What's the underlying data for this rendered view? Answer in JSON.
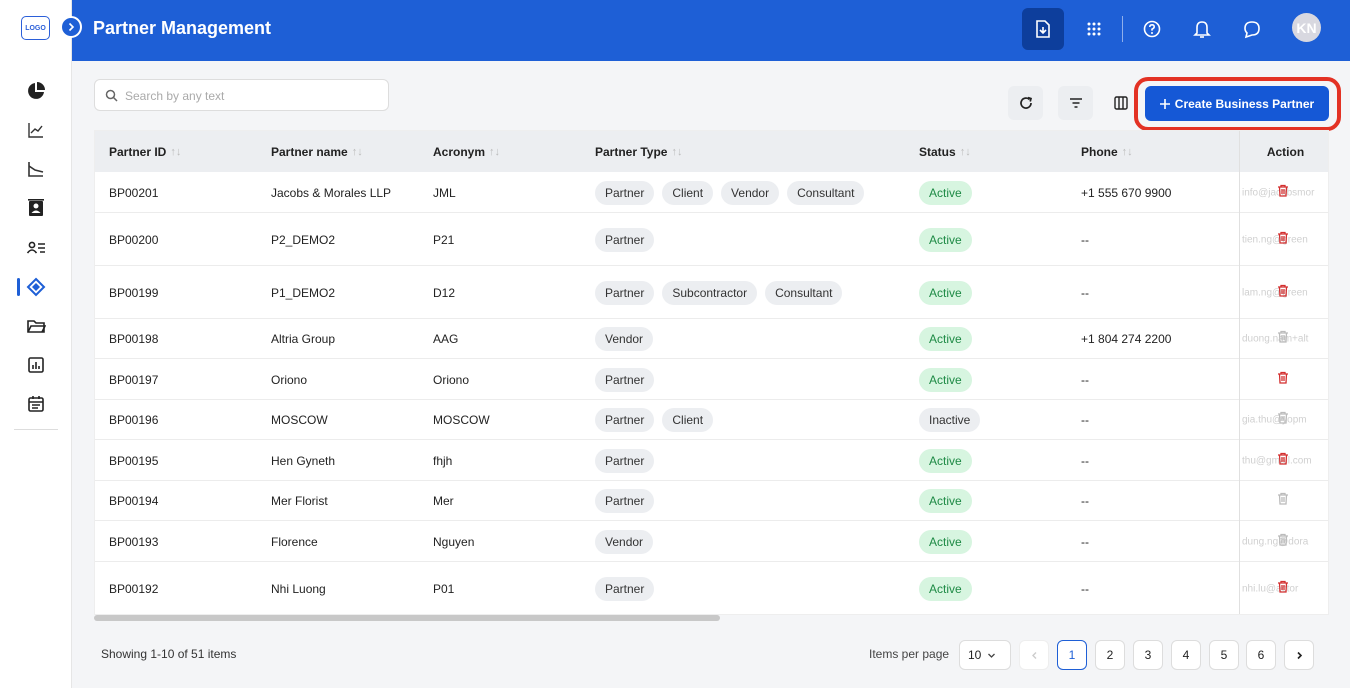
{
  "app": {
    "logo_text": "LOGO",
    "title": "Partner Management",
    "avatar_initials": "KN",
    "accent": "#1e5fd6"
  },
  "sidebar": {
    "items": [
      {
        "icon": "pie-chart-icon"
      },
      {
        "icon": "trend-chart-icon"
      },
      {
        "icon": "area-chart-icon"
      },
      {
        "icon": "contacts-icon"
      },
      {
        "icon": "user-list-icon"
      },
      {
        "icon": "handshake-icon",
        "active": true
      },
      {
        "icon": "folder-icon"
      },
      {
        "icon": "report-icon"
      },
      {
        "icon": "calendar-icon"
      }
    ]
  },
  "toolbar": {
    "search_placeholder": "Search by any text",
    "create_label": "Create Business Partner"
  },
  "table": {
    "headers": [
      "Partner ID",
      "Partner name",
      "Acronym",
      "Partner Type",
      "Status",
      "Phone",
      "Action"
    ],
    "rows": [
      {
        "id": "BP00201",
        "name": "Jacobs & Morales LLP",
        "acronym": "JML",
        "types": [
          "Partner",
          "Client",
          "Vendor",
          "Consultant"
        ],
        "status": "Active",
        "phone": "+1 555 670 9900",
        "ghost": "info@jacobsmor"
      },
      {
        "id": "BP00200",
        "name": "P2_DEMO2",
        "acronym": "P21",
        "types": [
          "Partner"
        ],
        "status": "Active",
        "phone": "--",
        "ghost": "tien.ng@green"
      },
      {
        "id": "BP00199",
        "name": "P1_DEMO2",
        "acronym": "D12",
        "types": [
          "Partner",
          "Subcontractor",
          "Consultant"
        ],
        "status": "Active",
        "phone": "--",
        "ghost": "lam.ng@green"
      },
      {
        "id": "BP00198",
        "name": "Altria Group",
        "acronym": "AAG",
        "types": [
          "Vendor"
        ],
        "status": "Active",
        "phone": "+1 804 274 2200",
        "ghost": "duong.nam+alt"
      },
      {
        "id": "BP00197",
        "name": "Oriono",
        "acronym": "Oriono",
        "types": [
          "Partner"
        ],
        "status": "Active",
        "phone": "--",
        "ghost": ""
      },
      {
        "id": "BP00196",
        "name": "MOSCOW",
        "acronym": "MOSCOW",
        "types": [
          "Partner",
          "Client"
        ],
        "status": "Inactive",
        "phone": "--",
        "ghost": "gia.thu@yopm"
      },
      {
        "id": "BP00195",
        "name": "Hen Gyneth",
        "acronym": "fhjh",
        "types": [
          "Partner"
        ],
        "status": "Active",
        "phone": "--",
        "ghost": "thu@gmail.com"
      },
      {
        "id": "BP00194",
        "name": "Mer Florist",
        "acronym": "Mer",
        "types": [
          "Partner"
        ],
        "status": "Active",
        "phone": "--",
        "ghost": ""
      },
      {
        "id": "BP00193",
        "name": "Florence",
        "acronym": "Nguyen",
        "types": [
          "Vendor"
        ],
        "status": "Active",
        "phone": "--",
        "ghost": "dung.ng@dora"
      },
      {
        "id": "BP00192",
        "name": "Nhi Luong",
        "acronym": "P01",
        "types": [
          "Partner"
        ],
        "status": "Active",
        "phone": "--",
        "ghost": "nhi.lu@actor"
      }
    ]
  },
  "footer": {
    "showing": "Showing 1-10 of 51 items",
    "items_per_page_label": "Items per page",
    "items_per_page": "10",
    "pages": [
      "1",
      "2",
      "3",
      "4",
      "5",
      "6"
    ],
    "current_page": "1"
  }
}
